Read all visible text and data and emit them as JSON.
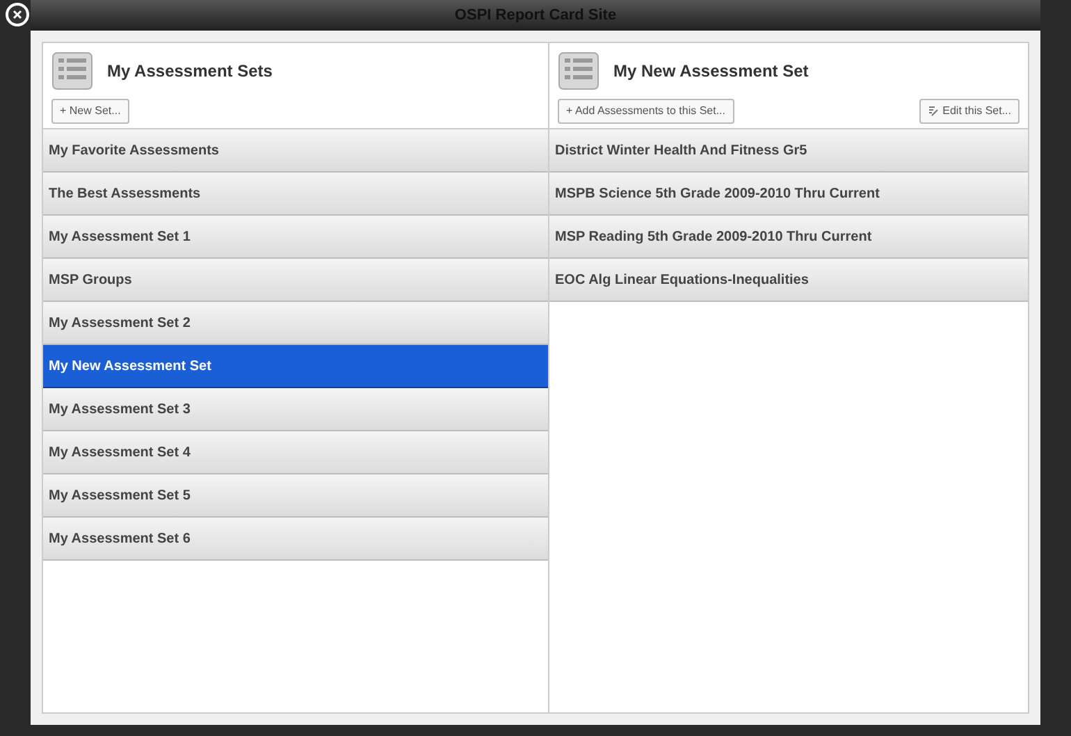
{
  "window": {
    "title": "OSPI Report Card Site"
  },
  "left_panel": {
    "title": "My Assessment Sets",
    "button": "+ New Set...",
    "items": [
      {
        "label": "My Favorite Assessments",
        "selected": false
      },
      {
        "label": "The Best Assessments",
        "selected": false
      },
      {
        "label": "My Assessment Set 1",
        "selected": false
      },
      {
        "label": "MSP Groups",
        "selected": false
      },
      {
        "label": "My Assessment Set 2",
        "selected": false
      },
      {
        "label": "My New Assessment Set",
        "selected": true
      },
      {
        "label": "My Assessment Set 3",
        "selected": false
      },
      {
        "label": "My Assessment Set 4",
        "selected": false
      },
      {
        "label": "My Assessment Set 5",
        "selected": false
      },
      {
        "label": "My Assessment Set 6",
        "selected": false
      }
    ]
  },
  "right_panel": {
    "title": "My New Assessment Set",
    "button": "+ Add Assessments to this Set...",
    "edit_button": "Edit this Set...",
    "items": [
      {
        "label": "District Winter Health And Fitness Gr5"
      },
      {
        "label": "MSPB Science 5th Grade 2009-2010 Thru Current"
      },
      {
        "label": "MSP Reading 5th Grade 2009-2010 Thru Current"
      },
      {
        "label": "EOC Alg Linear Equations-Inequalities"
      }
    ]
  }
}
